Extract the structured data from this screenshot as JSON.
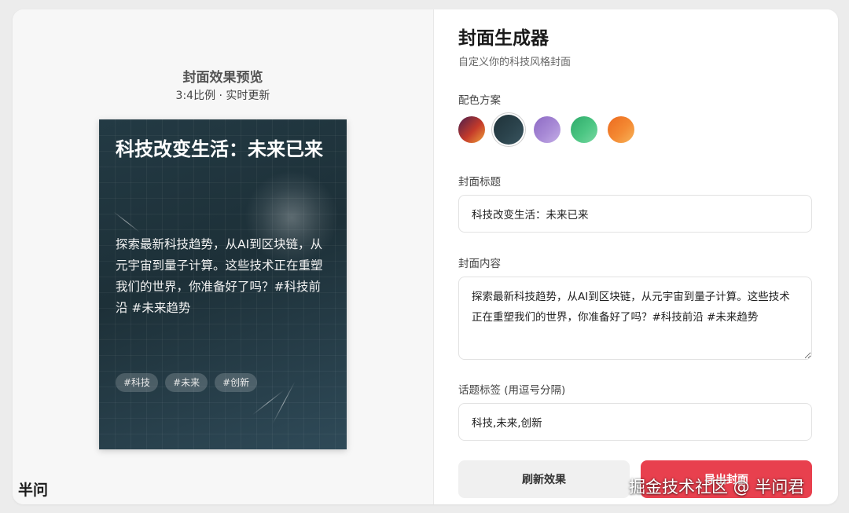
{
  "preview": {
    "title": "封面效果预览",
    "subtitle": "3:4比例 · 实时更新",
    "cover": {
      "title": "科技改变生活：未来已来",
      "body": "探索最新科技趋势，从AI到区块链，从元宇宙到量子计算。这些技术正在重塑我们的世界，你准备好了吗？#科技前沿 #未来趋势",
      "tags": [
        "#科技",
        "#未来",
        "#创新"
      ]
    },
    "brand": "半问"
  },
  "form": {
    "title": "封面生成器",
    "subtitle": "自定义你的科技风格封面",
    "color_scheme_label": "配色方案",
    "color_schemes": [
      {
        "name": "sunset",
        "from": "#4a1f4d",
        "via": "#c43a2a",
        "to": "#f0a23a",
        "selected": false
      },
      {
        "name": "dark-teal",
        "from": "#1f3239",
        "via": "#2b434c",
        "to": "#3a5560",
        "selected": true
      },
      {
        "name": "purple",
        "from": "#8d6ac4",
        "via": "#a88ad6",
        "to": "#c4aee6",
        "selected": false
      },
      {
        "name": "green",
        "from": "#2eaa6a",
        "via": "#4cc683",
        "to": "#7ad8a2",
        "selected": false
      },
      {
        "name": "orange",
        "from": "#ec6a1f",
        "via": "#f48a33",
        "to": "#f7b45a",
        "selected": false
      }
    ],
    "title_label": "封面标题",
    "title_value": "科技改变生活：未来已来",
    "content_label": "封面内容",
    "content_value": "探索最新科技趋势，从AI到区块链，从元宇宙到量子计算。这些技术正在重塑我们的世界，你准备好了吗？#科技前沿 #未来趋势",
    "tags_label": "话题标签 (用逗号分隔)",
    "tags_value": "科技,未来,创新",
    "refresh_label": "刷新效果",
    "export_label": "导出封面"
  },
  "watermark": "掘金技术社区 @ 半问君",
  "colors": {
    "accent": "#e8404e",
    "cover_bg": "#233a44"
  }
}
